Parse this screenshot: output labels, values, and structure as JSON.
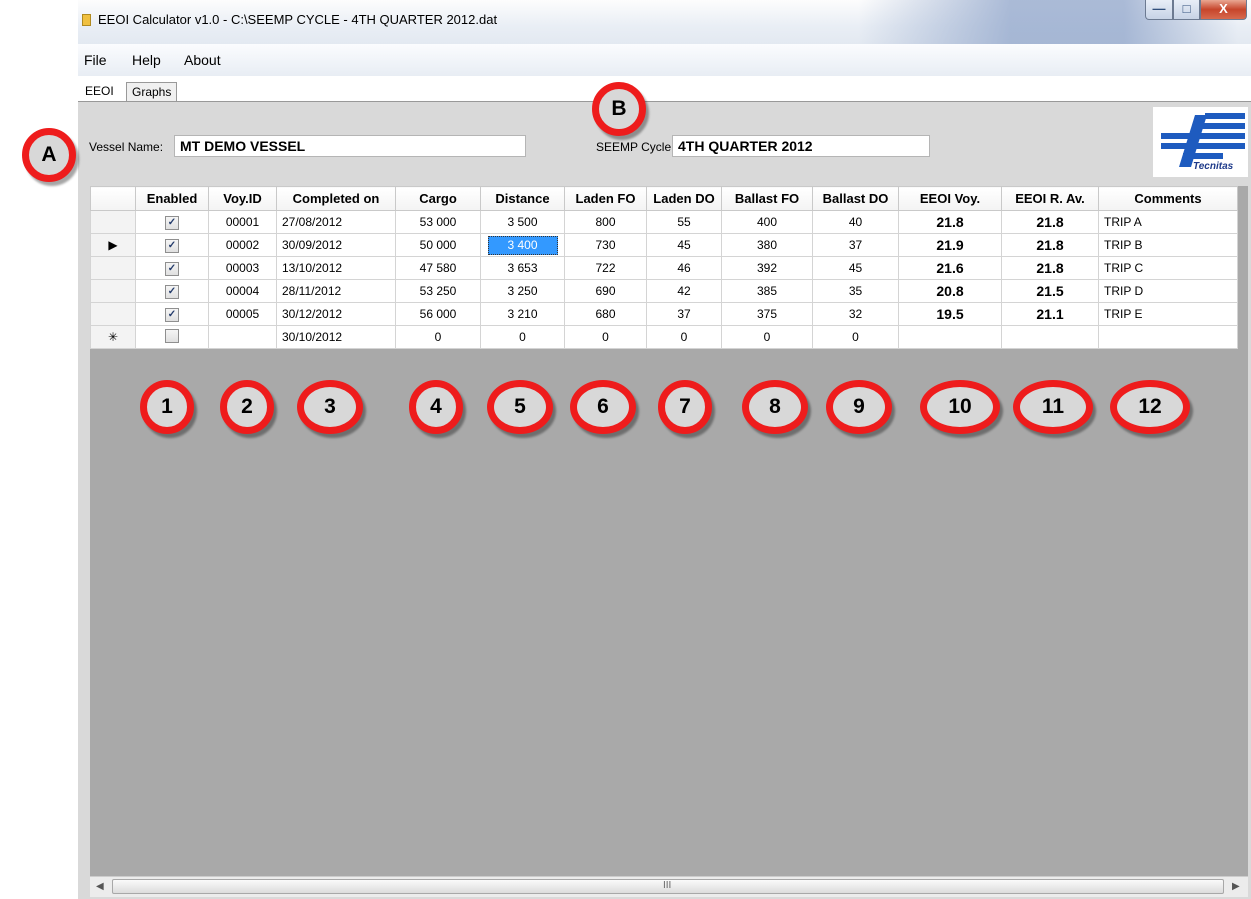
{
  "window": {
    "title": "EEOI Calculator v1.0 - C:\\SEEMP CYCLE - 4TH QUARTER 2012.dat",
    "controls": {
      "minimize": "—",
      "maximize": "□",
      "close": "X"
    }
  },
  "menu": [
    "File",
    "Help",
    "About"
  ],
  "tabs": [
    {
      "label": "EEOI",
      "active": true
    },
    {
      "label": "Graphs",
      "active": false
    }
  ],
  "vessel": {
    "label": "Vessel Name:",
    "value": "MT DEMO VESSEL"
  },
  "seemp": {
    "label": "SEEMP Cycle:",
    "value": "4TH QUARTER 2012"
  },
  "logo": {
    "text": "Tecnitas"
  },
  "grid": {
    "columns": [
      "Enabled",
      "Voy.ID",
      "Completed on",
      "Cargo",
      "Distance",
      "Laden FO",
      "Laden DO",
      "Ballast FO",
      "Ballast DO",
      "EEOI Voy.",
      "EEOI R. Av.",
      "Comments"
    ],
    "rows": [
      {
        "marker": "",
        "enabled": true,
        "voy_id": "00001",
        "completed": "27/08/2012",
        "cargo": "53 000",
        "distance": "3 500",
        "laden_fo": "800",
        "laden_do": "55",
        "ballast_fo": "400",
        "ballast_do": "40",
        "eeoi_voy": "21.8",
        "eeoi_avg": "21.8",
        "comments": "TRIP A"
      },
      {
        "marker": "▶",
        "enabled": true,
        "voy_id": "00002",
        "completed": "30/09/2012",
        "cargo": "50 000",
        "distance": "3 400",
        "laden_fo": "730",
        "laden_do": "45",
        "ballast_fo": "380",
        "ballast_do": "37",
        "eeoi_voy": "21.9",
        "eeoi_avg": "21.8",
        "comments": "TRIP B"
      },
      {
        "marker": "",
        "enabled": true,
        "voy_id": "00003",
        "completed": "13/10/2012",
        "cargo": "47 580",
        "distance": "3 653",
        "laden_fo": "722",
        "laden_do": "46",
        "ballast_fo": "392",
        "ballast_do": "45",
        "eeoi_voy": "21.6",
        "eeoi_avg": "21.8",
        "comments": "TRIP C"
      },
      {
        "marker": "",
        "enabled": true,
        "voy_id": "00004",
        "completed": "28/11/2012",
        "cargo": "53 250",
        "distance": "3 250",
        "laden_fo": "690",
        "laden_do": "42",
        "ballast_fo": "385",
        "ballast_do": "35",
        "eeoi_voy": "20.8",
        "eeoi_avg": "21.5",
        "comments": "TRIP D"
      },
      {
        "marker": "",
        "enabled": true,
        "voy_id": "00005",
        "completed": "30/12/2012",
        "cargo": "56 000",
        "distance": "3 210",
        "laden_fo": "680",
        "laden_do": "37",
        "ballast_fo": "375",
        "ballast_do": "32",
        "eeoi_voy": "19.5",
        "eeoi_avg": "21.1",
        "comments": "TRIP E"
      },
      {
        "marker": "✳",
        "enabled": false,
        "voy_id": "",
        "completed": "30/10/2012",
        "cargo": "0",
        "distance": "0",
        "laden_fo": "0",
        "laden_do": "0",
        "ballast_fo": "0",
        "ballast_do": "0",
        "eeoi_voy": "",
        "eeoi_avg": "",
        "comments": ""
      }
    ]
  },
  "scrollbar": {
    "left": "◀",
    "right": "▶",
    "grip": "III"
  },
  "callouts": {
    "A": "A",
    "B": "B",
    "numbers": [
      "1",
      "2",
      "3",
      "4",
      "5",
      "6",
      "7",
      "8",
      "9",
      "10",
      "11",
      "12"
    ]
  },
  "colors": {
    "callout_ring": "#ee1c1c",
    "selection": "#3399ff",
    "grid_background": "#a9a9a9"
  }
}
